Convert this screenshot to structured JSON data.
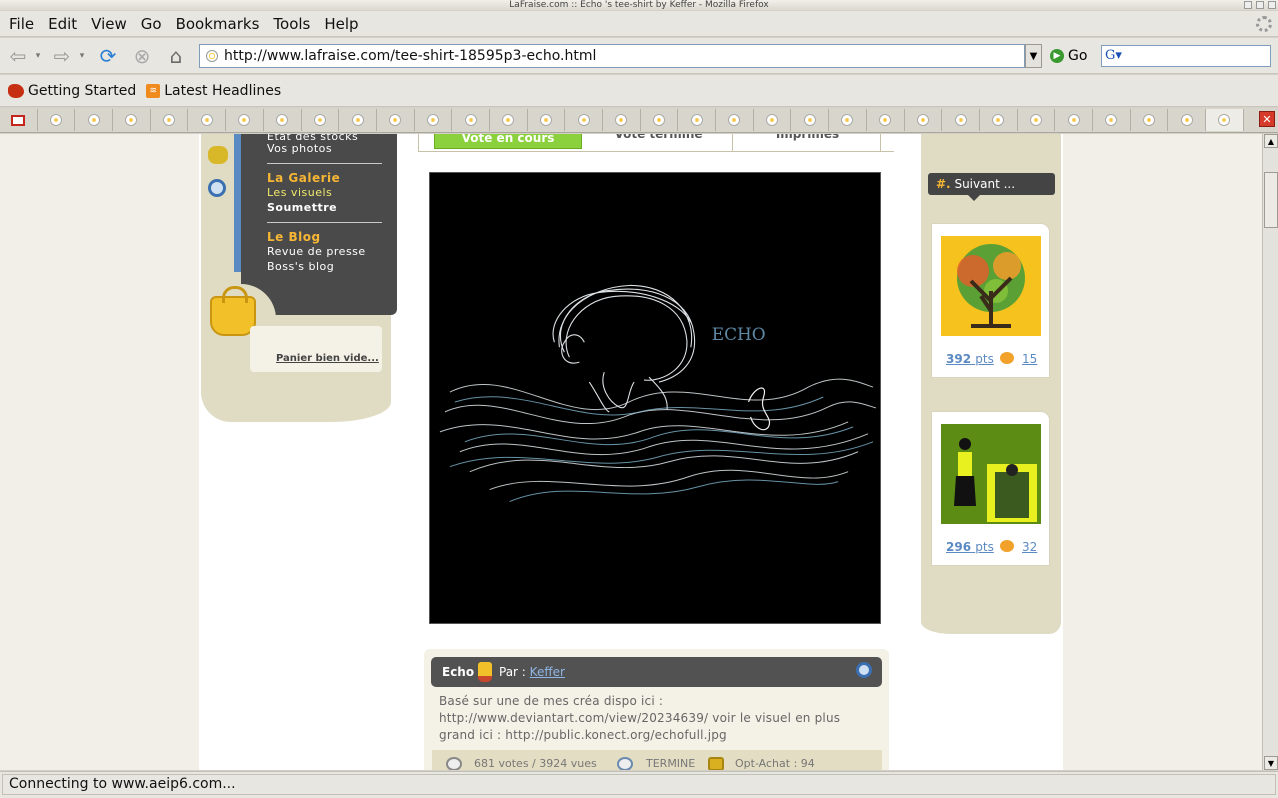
{
  "window": {
    "title": "LaFraise.com :: Echo 's tee-shirt by Keffer - Mozilla Firefox"
  },
  "menu": [
    "File",
    "Edit",
    "View",
    "Go",
    "Bookmarks",
    "Tools",
    "Help"
  ],
  "nav": {
    "url": "http://www.lafraise.com/tee-shirt-18595p3-echo.html",
    "go_label": "Go",
    "search_value": ""
  },
  "bookmarks": [
    "Getting Started",
    "Latest Headlines"
  ],
  "status": {
    "text": "Connecting to www.aeip6.com..."
  },
  "page": {
    "left_menu": {
      "stocks": "Etat des stocks",
      "photos": "Vos photos",
      "galerie_head": "La Galerie",
      "visuels": "Les visuels",
      "soumettre": "Soumettre",
      "blog_head": "Le Blog",
      "presse": "Revue de presse",
      "boss": "Boss's blog",
      "panier": "Panier bien vide..."
    },
    "vote_tabs": [
      "Vote en cours",
      "Vote terminé",
      "Imprimés"
    ],
    "art_label": "ECHO",
    "suivant": {
      "hash": "#.",
      "label": "Suivant ..."
    },
    "thumbs": [
      {
        "pts": "392",
        "unit": "pts",
        "comments": "15"
      },
      {
        "pts": "296",
        "unit": "pts",
        "comments": "32"
      }
    ],
    "info": {
      "title": "Echo",
      "par": "Par :",
      "author": "Keffer",
      "description": "Basé sur une de mes créa dispo ici : http://www.deviantart.com/view/20234639/ voir le visuel en plus grand ici : http://public.konect.org/echofull.jpg",
      "votes": "681 votes / 3924 vues",
      "state": "TERMINE",
      "opt": "Opt-Achat : 94"
    }
  },
  "colors": {
    "accent_green": "#8bd13e",
    "accent_orange": "#f7b634",
    "panel_beige": "#e0dcc4",
    "dark_menu": "#4a4a4a"
  }
}
